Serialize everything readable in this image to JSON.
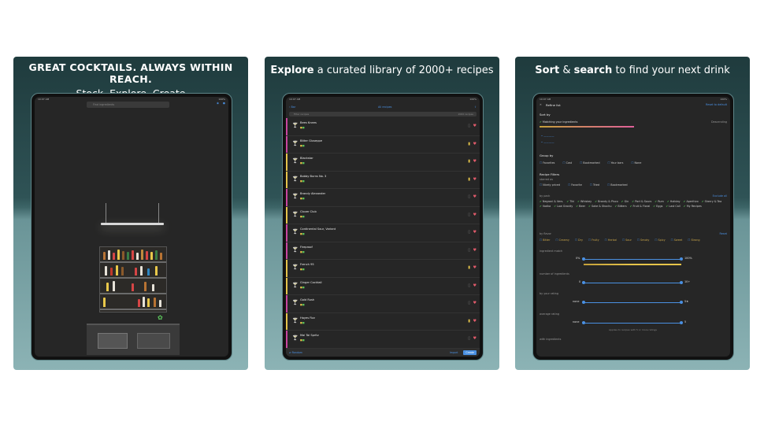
{
  "panels": [
    {
      "caption_line1": "GREAT COCKTAILS. ALWAYS WITHIN REACH.",
      "caption_line2": "Stock. Explore. Create",
      "search_placeholder": "Find ingredients"
    },
    {
      "caption_bold": "Explore",
      "caption_rest": "a curated library of 2000+ recipes",
      "back_label": "Bar",
      "nav_title": "All recipes",
      "filter_placeholder": "Filter recipes",
      "filter_count": "2000 recipes",
      "recipes": [
        {
          "name": "Bees Knees",
          "color": "#c946a0",
          "bookmarked": false
        },
        {
          "name": "Bitter Giuseppe",
          "color": "#c946a0",
          "bookmarked": true
        },
        {
          "name": "Blackstar",
          "color": "#e6c44a",
          "bookmarked": true
        },
        {
          "name": "Bobby Burns No. 3",
          "color": "#e6c44a",
          "bookmarked": true
        },
        {
          "name": "Brandy Alexander",
          "color": "#c946a0",
          "bookmarked": false
        },
        {
          "name": "Clover Club",
          "color": "#e6c44a",
          "bookmarked": false
        },
        {
          "name": "Continental Sour, Variant",
          "color": "#c946a0",
          "bookmarked": false
        },
        {
          "name": "Fireproof",
          "color": "#c946a0",
          "bookmarked": false
        },
        {
          "name": "French 95",
          "color": "#e6c44a",
          "bookmarked": true
        },
        {
          "name": "Ginger Cocktail",
          "color": "#e6c44a",
          "bookmarked": false
        },
        {
          "name": "Gold Rush",
          "color": "#c946a0",
          "bookmarked": false
        },
        {
          "name": "Hayes Fizz",
          "color": "#e6c44a",
          "bookmarked": true
        },
        {
          "name": "Mai Tai Spritz",
          "color": "#c946a0",
          "bookmarked": false
        }
      ],
      "footer_left": "Random",
      "footer_import": "Import",
      "footer_create": "Create"
    },
    {
      "caption_bold1": "Sort",
      "caption_mid": "&",
      "caption_bold2": "search",
      "caption_rest": "to find your next drink",
      "title": "Refine list",
      "reset": "Reset to default",
      "sort_by": "Sort by",
      "sort_option": "Matching your ingredients",
      "sort_dir": "Descending",
      "group_by": "Group by",
      "group_options": [
        "Favorites",
        "Cost",
        "Bookmarked",
        "Your bars",
        "None"
      ],
      "recipe_filters": "Recipe Filters",
      "starred_as": "starred as",
      "starred_options": [
        "Nicely priced",
        "Favorite",
        "Tried",
        "Bookmarked"
      ],
      "by_pack": "by pack",
      "exclude_all": "Exclude all",
      "packs": [
        "Negroni & Vers.",
        "Tiki",
        "Whiskey",
        "Brandy & Pisco",
        "Gin",
        "Port & Sours",
        "Rum",
        "Holiday",
        "Aperitivo",
        "Sherry & Tea",
        "Vodka",
        "Low Gravity",
        "Beer",
        "Sake & Shochu",
        "Bitters",
        "Fruit & Floral",
        "Eggs",
        "Last Call",
        "My Recipes"
      ],
      "by_flavor": "by flavor",
      "flavor_reset": "Reset",
      "flavors": [
        "Bitter",
        "Creamy",
        "Dry",
        "Fruity",
        "Herbal",
        "Sour",
        "Smoky",
        "Spicy",
        "Sweet",
        "Strong"
      ],
      "ingredient_match": "ingredient match",
      "ingredient_min": "0%",
      "ingredient_max": "100%",
      "num_ingredients": "number of ingredients",
      "num_min": "0",
      "num_max": "10+",
      "by_rating": "by your rating",
      "rating_min": "none",
      "rating_max": "5★",
      "avg_rating": "average rating",
      "avg_min": "none",
      "avg_max": "5",
      "avg_note": "Applies to recipes with 5 or more ratings",
      "with_ingredients": "with ingredients"
    }
  ],
  "colors": {
    "accent": "#4a90e2",
    "heart": "#e05a6a",
    "bookmark": "#e6c44a",
    "check": "#5cc85c"
  }
}
